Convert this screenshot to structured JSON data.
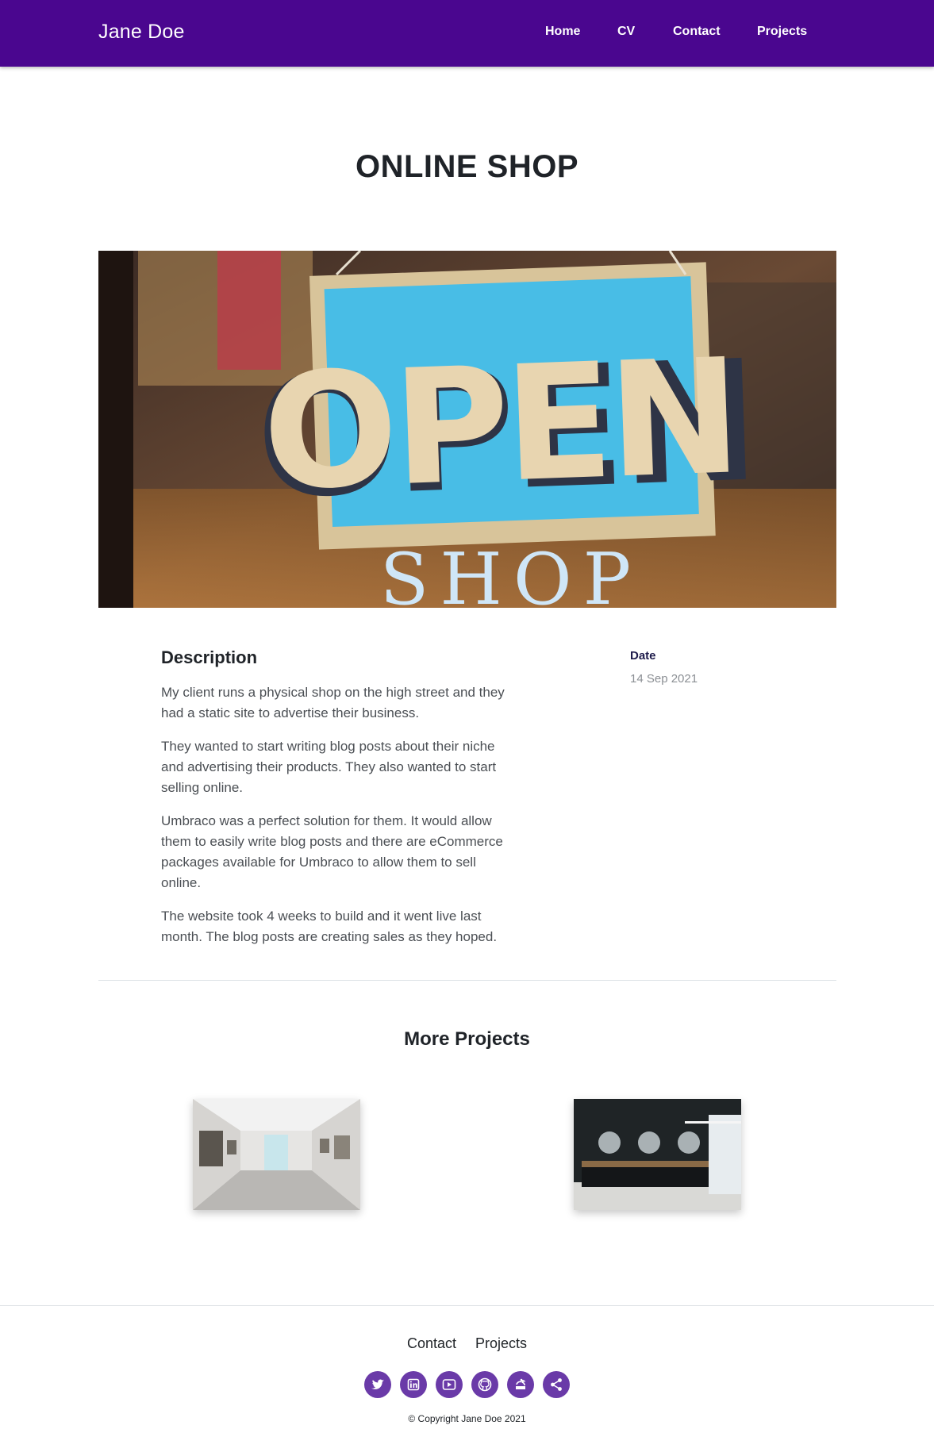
{
  "header": {
    "brand": "Jane Doe",
    "nav": [
      "Home",
      "CV",
      "Contact",
      "Projects"
    ],
    "background_color": "#4a068f"
  },
  "page": {
    "title": "ONLINE SHOP",
    "hero_image": {
      "sign_text": "OPEN",
      "window_text": "SHOP",
      "icon": "open-sign-photo"
    }
  },
  "details": {
    "description_heading": "Description",
    "paragraphs": [
      "My client runs a physical shop on the high street and they had a static site to advertise their business.",
      "They wanted to start writing blog posts about their niche and advertising their products. They also wanted to start selling online.",
      "Umbraco was a perfect solution for them. It would allow them to easily write blog posts and there are eCommerce packages available for Umbraco to allow them to sell online.",
      "The website took 4 weeks to build and it went live last month. The blog posts are creating sales as they hoped."
    ],
    "date_label": "Date",
    "date_value": "14 Sep 2021"
  },
  "more_projects": {
    "heading": "More Projects",
    "items": [
      {
        "icon": "art-gallery-photo"
      },
      {
        "icon": "salon-interior-photo"
      }
    ]
  },
  "footer": {
    "links": [
      "Contact",
      "Projects"
    ],
    "socials": [
      "twitter-icon",
      "linkedin-icon",
      "youtube-icon",
      "github-icon",
      "stackoverflow-icon",
      "share-icon"
    ],
    "social_color": "#6a3aa8",
    "copyright": "© Copyright Jane Doe 2021"
  }
}
